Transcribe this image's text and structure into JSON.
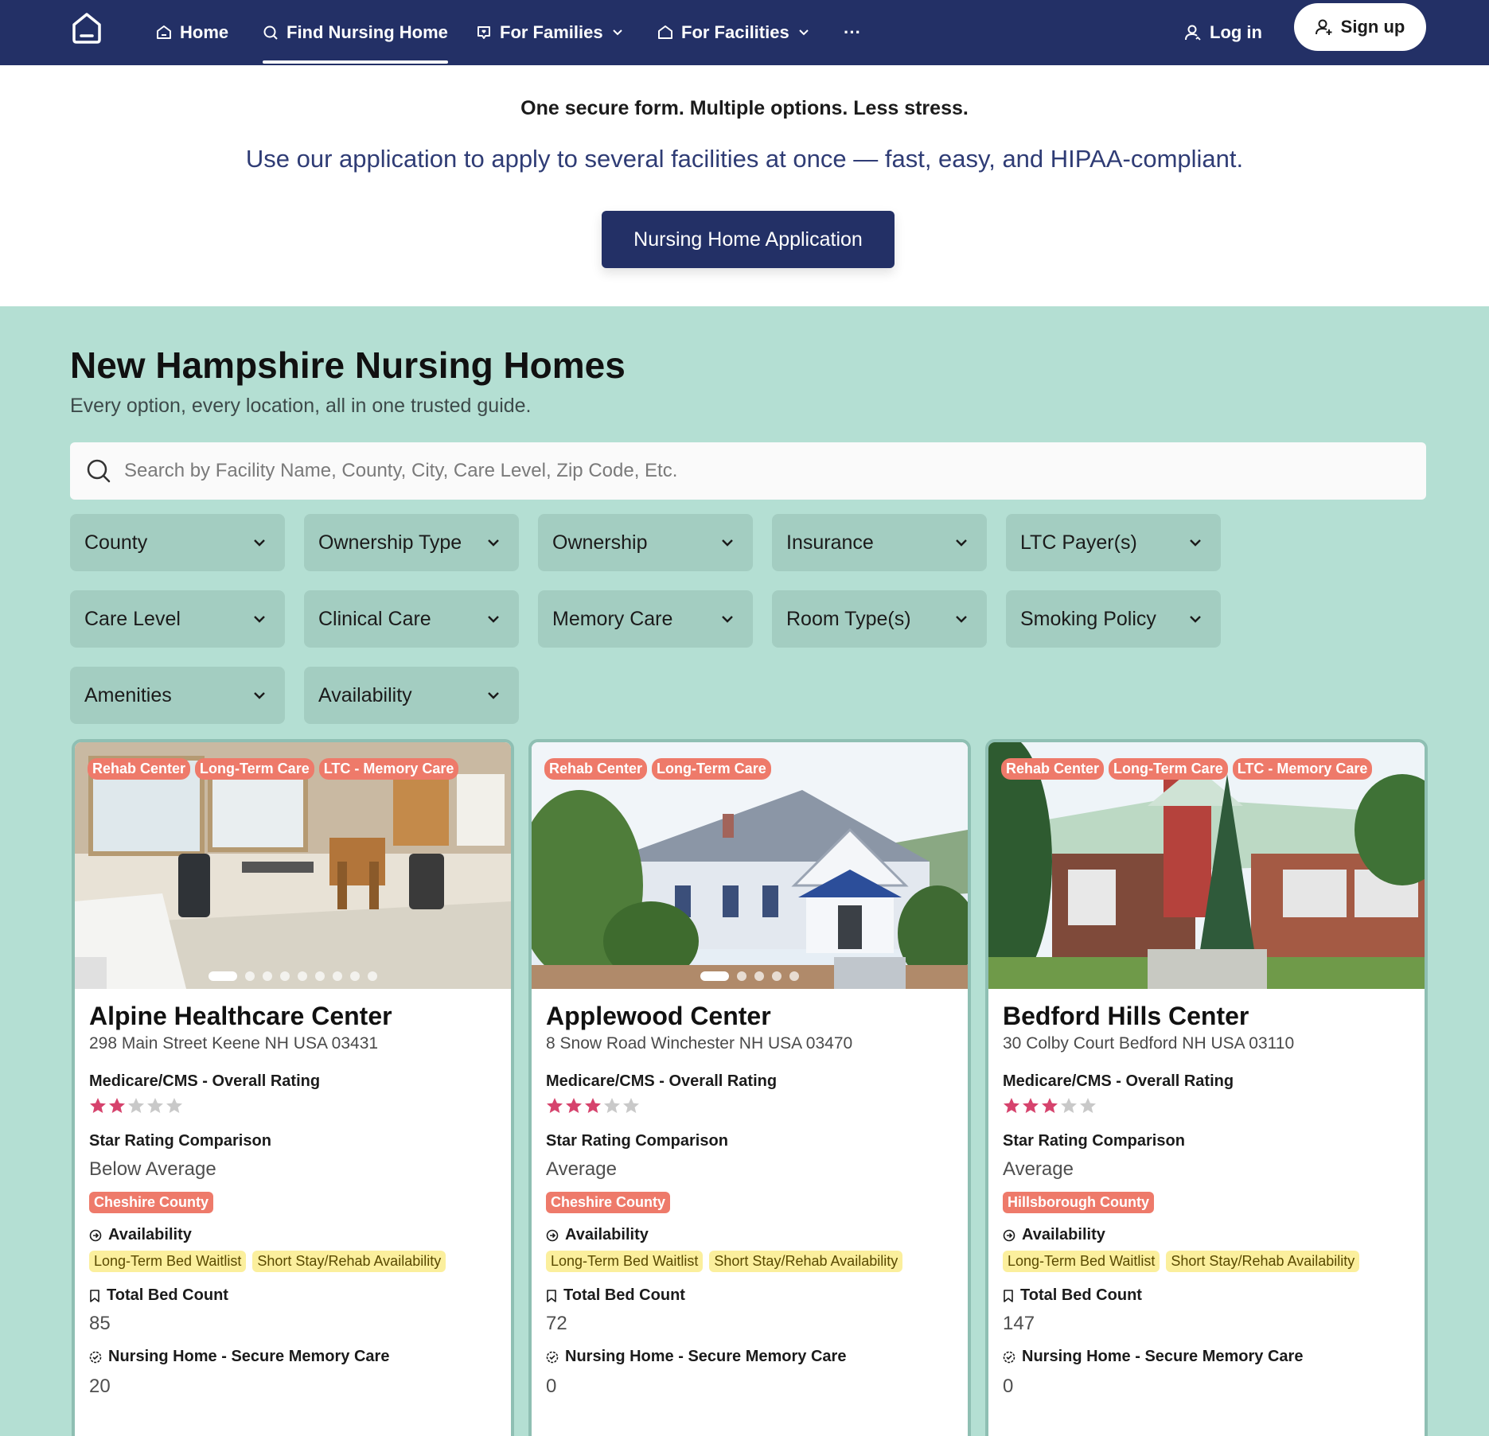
{
  "nav": {
    "items": [
      {
        "label": "Home",
        "icon": "home-icon"
      },
      {
        "label": "Find Nursing Home",
        "icon": "search-icon"
      },
      {
        "label": "For Families",
        "icon": "heart-chat-icon"
      },
      {
        "label": "For Facilities",
        "icon": "home-icon"
      }
    ],
    "more_label": "···",
    "login_label": "Log in",
    "signup_label": "Sign up"
  },
  "hero": {
    "tagline": "One secure form. Multiple options. Less stress.",
    "subtitle": "Use our application to apply to several facilities at once — fast, easy, and HIPAA-compliant.",
    "button_label": "Nursing Home Application"
  },
  "listing": {
    "title": "New Hampshire Nursing Homes",
    "subtitle": "Every option, every location, all in one trusted guide.",
    "search_placeholder": "Search by Facility Name, County, City, Care Level, Zip Code, Etc."
  },
  "filters": [
    "County",
    "Ownership Type",
    "Ownership",
    "Insurance",
    "LTC Payer(s)",
    "Care Level",
    "Clinical Care",
    "Memory Care",
    "Room Type(s)",
    "Smoking Policy",
    "Amenities",
    "Availability"
  ],
  "labels": {
    "rating": "Medicare/CMS - Overall Rating",
    "comparison": "Star Rating Comparison",
    "availability": "Availability",
    "beds": "Total Bed Count",
    "memory": "Nursing Home - Secure Memory Care"
  },
  "cards": [
    {
      "name": "Alpine Healthcare Center",
      "address": "298 Main Street Keene NH USA 03431",
      "tags": [
        "Rehab Center",
        "Long-Term Care",
        "LTC - Memory Care"
      ],
      "stars": 2,
      "comparison": "Below Average",
      "county": "Cheshire County",
      "availability": [
        "Long-Term Bed Waitlist",
        "Short Stay/Rehab Availability"
      ],
      "beds": "85",
      "memory": "20",
      "photo_count": 9,
      "photo_index": 1
    },
    {
      "name": "Applewood Center",
      "address": "8 Snow Road Winchester NH USA 03470",
      "tags": [
        "Rehab Center",
        "Long-Term Care"
      ],
      "stars": 3,
      "comparison": "Average",
      "county": "Cheshire County",
      "availability": [
        "Long-Term Bed Waitlist",
        "Short Stay/Rehab Availability"
      ],
      "beds": "72",
      "memory": "0",
      "photo_count": 5,
      "photo_index": 1
    },
    {
      "name": "Bedford Hills Center",
      "address": "30 Colby Court Bedford NH USA 03110",
      "tags": [
        "Rehab Center",
        "Long-Term Care",
        "LTC - Memory Care"
      ],
      "stars": 3,
      "comparison": "Average",
      "county": "Hillsborough County",
      "availability": [
        "Long-Term Bed Waitlist",
        "Short Stay/Rehab Availability"
      ],
      "beds": "147",
      "memory": "0",
      "photo_count": 1,
      "photo_index": 1
    }
  ],
  "colors": {
    "nav_bg": "#233066",
    "page_bg": "#b4dfd3",
    "tag": "#ee7a6a",
    "availability_tag": "#fbef9d",
    "star_on": "#d6436d",
    "star_off": "#c9c9c9"
  }
}
